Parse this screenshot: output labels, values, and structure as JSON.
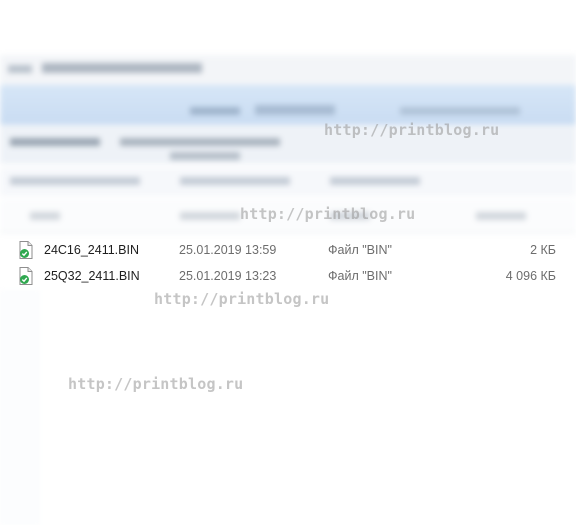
{
  "watermark": {
    "text": "http://printblog.ru"
  },
  "files": [
    {
      "name": "24C16_2411.BIN",
      "modified": "25.01.2019 13:59",
      "type": "Файл \"BIN\"",
      "size": "2 КБ",
      "icon": "bin-file-synced-icon"
    },
    {
      "name": "25Q32_2411.BIN",
      "modified": "25.01.2019 13:23",
      "type": "Файл \"BIN\"",
      "size": "4 096 КБ",
      "icon": "bin-file-synced-icon"
    }
  ],
  "colors": {
    "ribbon": "#c9dcf2",
    "sync_badge": "#2fa84f",
    "text_primary": "#1e1e1e",
    "text_secondary": "#6d6d6d"
  }
}
